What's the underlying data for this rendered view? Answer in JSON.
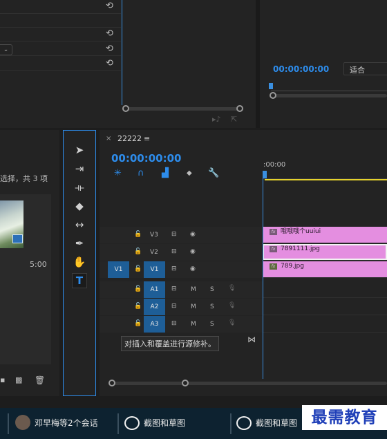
{
  "program_monitor": {
    "timecode": "00:00:00:00",
    "fit_label": "适合"
  },
  "project": {
    "selection_text": "选择，共 3 项",
    "clip_duration": "5:00"
  },
  "timeline": {
    "sequence_name": "22222",
    "timecode": "00:00:00:00",
    "ruler_start": ":00:00",
    "tracks": {
      "v3": {
        "label": "V3",
        "clip": "哦哦哦个uuiui"
      },
      "v2": {
        "label": "V2",
        "clip": "7891111.jpg"
      },
      "v1": {
        "label": "V1",
        "source": "V1",
        "clip": "789.jpg"
      },
      "a1": {
        "label": "A1",
        "mute": "M",
        "solo": "S"
      },
      "a2": {
        "label": "A2",
        "mute": "M",
        "solo": "S"
      },
      "a3": {
        "label": "A3",
        "mute": "M",
        "solo": "S"
      }
    },
    "tooltip": "对插入和覆盖进行源修补。"
  },
  "taskbar": {
    "items": [
      {
        "label": "邓早梅等2个会话"
      },
      {
        "label": "截图和草图"
      },
      {
        "label": "截图和草图"
      }
    ],
    "watermark": "最需教育"
  },
  "colors": {
    "accent_blue": "#2d8ceb",
    "clip_pink": "#e48ee0",
    "playhead_blue": "#3a8fe0",
    "work_area_yellow": "#e6d22d"
  }
}
